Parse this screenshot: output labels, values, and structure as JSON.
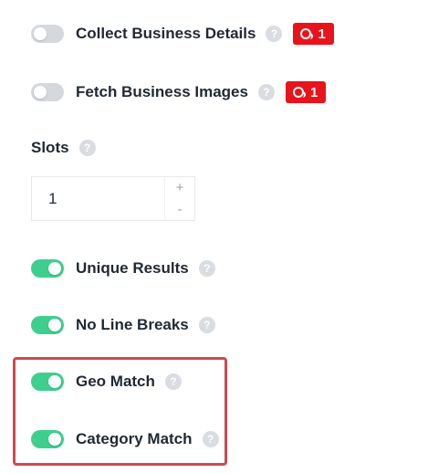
{
  "settings": {
    "collect_business_details": {
      "label": "Collect Business Details",
      "help": "?",
      "enabled": false,
      "credits": "1"
    },
    "fetch_business_images": {
      "label": "Fetch Business Images",
      "help": "?",
      "enabled": false,
      "credits": "1"
    },
    "slots": {
      "label": "Slots",
      "help": "?",
      "value": "1",
      "increment": "+",
      "decrement": "-"
    },
    "unique_results": {
      "label": "Unique Results",
      "help": "?",
      "enabled": true
    },
    "no_line_breaks": {
      "label": "No Line Breaks",
      "help": "?",
      "enabled": true
    },
    "geo_match": {
      "label": "Geo Match",
      "help": "?",
      "enabled": true
    },
    "category_match": {
      "label": "Category Match",
      "help": "?",
      "enabled": true
    }
  },
  "colors": {
    "toggle_on": "#3ecf8e",
    "toggle_off": "#d5d8dc",
    "badge": "#e8131b",
    "highlight_border": "#d0494f"
  },
  "icons": {
    "help": "question-mark-circle-icon",
    "credits": "coin-icon"
  }
}
